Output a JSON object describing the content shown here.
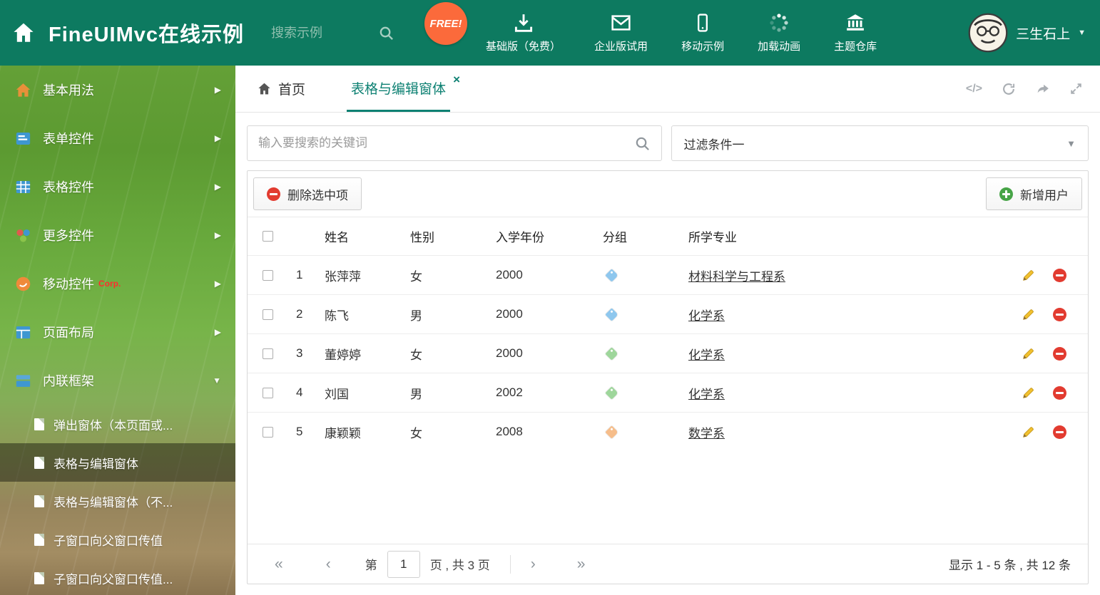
{
  "header": {
    "title": "FineUIMvc在线示例",
    "search_placeholder": "搜索示例",
    "free_badge": "FREE!",
    "nav": [
      {
        "label": "基础版（免费）"
      },
      {
        "label": "企业版试用"
      },
      {
        "label": "移动示例"
      },
      {
        "label": "加载动画"
      },
      {
        "label": "主题仓库"
      }
    ],
    "user_name": "三生石上"
  },
  "sidebar": {
    "items": [
      {
        "label": "基本用法",
        "arrow": "▶"
      },
      {
        "label": "表单控件",
        "arrow": "▶"
      },
      {
        "label": "表格控件",
        "arrow": "▶"
      },
      {
        "label": "更多控件",
        "arrow": "▶"
      },
      {
        "label": "移动控件",
        "badge": "Corp.",
        "arrow": "▶"
      },
      {
        "label": "页面布局",
        "arrow": "▶"
      },
      {
        "label": "内联框架",
        "arrow": "▼"
      }
    ],
    "subitems": [
      {
        "label": "弹出窗体（本页面或..."
      },
      {
        "label": "表格与编辑窗体",
        "active": true
      },
      {
        "label": "表格与编辑窗体（不..."
      },
      {
        "label": "子窗口向父窗口传值"
      },
      {
        "label": "子窗口向父窗口传值..."
      }
    ]
  },
  "tabs": {
    "home": "首页",
    "active": "表格与编辑窗体"
  },
  "filterbar": {
    "search_placeholder": "输入要搜索的关键词",
    "filter_value": "过滤条件一"
  },
  "toolbar": {
    "delete_label": "删除选中项",
    "add_label": "新增用户"
  },
  "table": {
    "columns": [
      "姓名",
      "性别",
      "入学年份",
      "分组",
      "所学专业"
    ],
    "rows": [
      {
        "num": "1",
        "name": "张萍萍",
        "gender": "女",
        "year": "2000",
        "tag_color": "#8ec7ee",
        "major": "材料科学与工程系"
      },
      {
        "num": "2",
        "name": "陈飞",
        "gender": "男",
        "year": "2000",
        "tag_color": "#8ec7ee",
        "major": "化学系"
      },
      {
        "num": "3",
        "name": "董婷婷",
        "gender": "女",
        "year": "2000",
        "tag_color": "#9ed69b",
        "major": "化学系"
      },
      {
        "num": "4",
        "name": "刘国",
        "gender": "男",
        "year": "2002",
        "tag_color": "#9ed69b",
        "major": "化学系"
      },
      {
        "num": "5",
        "name": "康颖颖",
        "gender": "女",
        "year": "2008",
        "tag_color": "#f6bd8a",
        "major": "数学系"
      }
    ]
  },
  "pagination": {
    "prefix": "第",
    "page": "1",
    "suffix": "页 , 共 3 页",
    "summary": "显示 1 - 5 条 , 共 12 条"
  },
  "icons": {
    "caret_down": "▼",
    "close": "×",
    "code": "</>",
    "first": "«",
    "prev": "‹",
    "next": "›",
    "last": "»"
  }
}
